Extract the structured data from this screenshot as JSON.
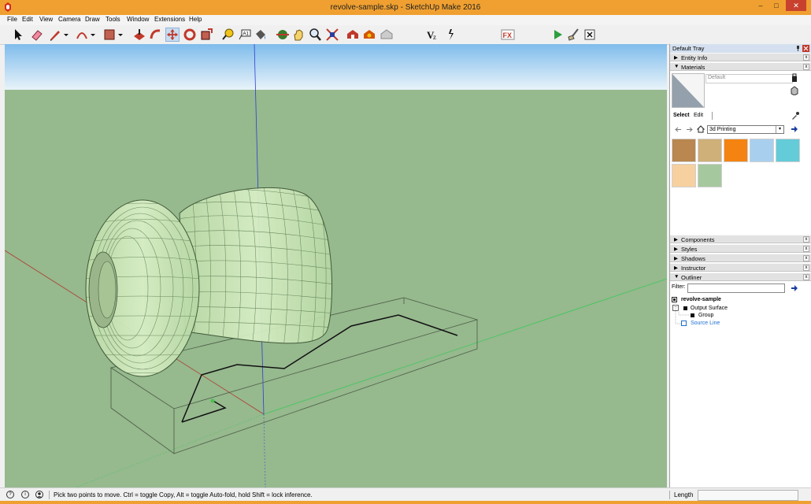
{
  "window": {
    "title": "revolve-sample.skp - SketchUp Make 2016",
    "min_glyph": "–",
    "max_glyph": "□",
    "close_glyph": "✕"
  },
  "menu": [
    "File",
    "Edit",
    "View",
    "Camera",
    "Draw",
    "Tools",
    "Window",
    "Extensions",
    "Help"
  ],
  "tray": {
    "title": "Default Tray",
    "sections_top": [
      {
        "label": "Entity Info",
        "expanded": false
      },
      {
        "label": "Materials",
        "expanded": true
      }
    ],
    "materials": {
      "name_placeholder": "Default",
      "tab_select": "Select",
      "tab_edit": "Edit",
      "library": "3d Printing",
      "swatches": [
        "#b9874f",
        "#cfb079",
        "#f48311",
        "#a9cfee",
        "#64cbd8",
        "#f6d09f",
        "#a6c89e"
      ]
    },
    "sections_bottom": [
      {
        "label": "Components",
        "expanded": false
      },
      {
        "label": "Styles",
        "expanded": false
      },
      {
        "label": "Shadows",
        "expanded": false
      },
      {
        "label": "Instructor",
        "expanded": false
      },
      {
        "label": "Outliner",
        "expanded": true
      }
    ],
    "outliner": {
      "filter_label": "Filter:",
      "root": "revolve-sample",
      "items": [
        "Output Surface",
        "Group",
        "Source Line"
      ]
    }
  },
  "status": {
    "message": "Pick two points to move.  Ctrl = toggle Copy, Alt = toggle Auto-fold, hold Shift = lock inference.",
    "measure_label": "Length",
    "measure_value": ""
  },
  "colors": {
    "titlebar": "#f0a030",
    "sky": "#8ec4ef",
    "ground": "#96b98e",
    "model_fill": "#c8e7b4",
    "axis_red": "#c0392b",
    "axis_green": "#2ecc40",
    "axis_blue": "#2c3fcf"
  }
}
